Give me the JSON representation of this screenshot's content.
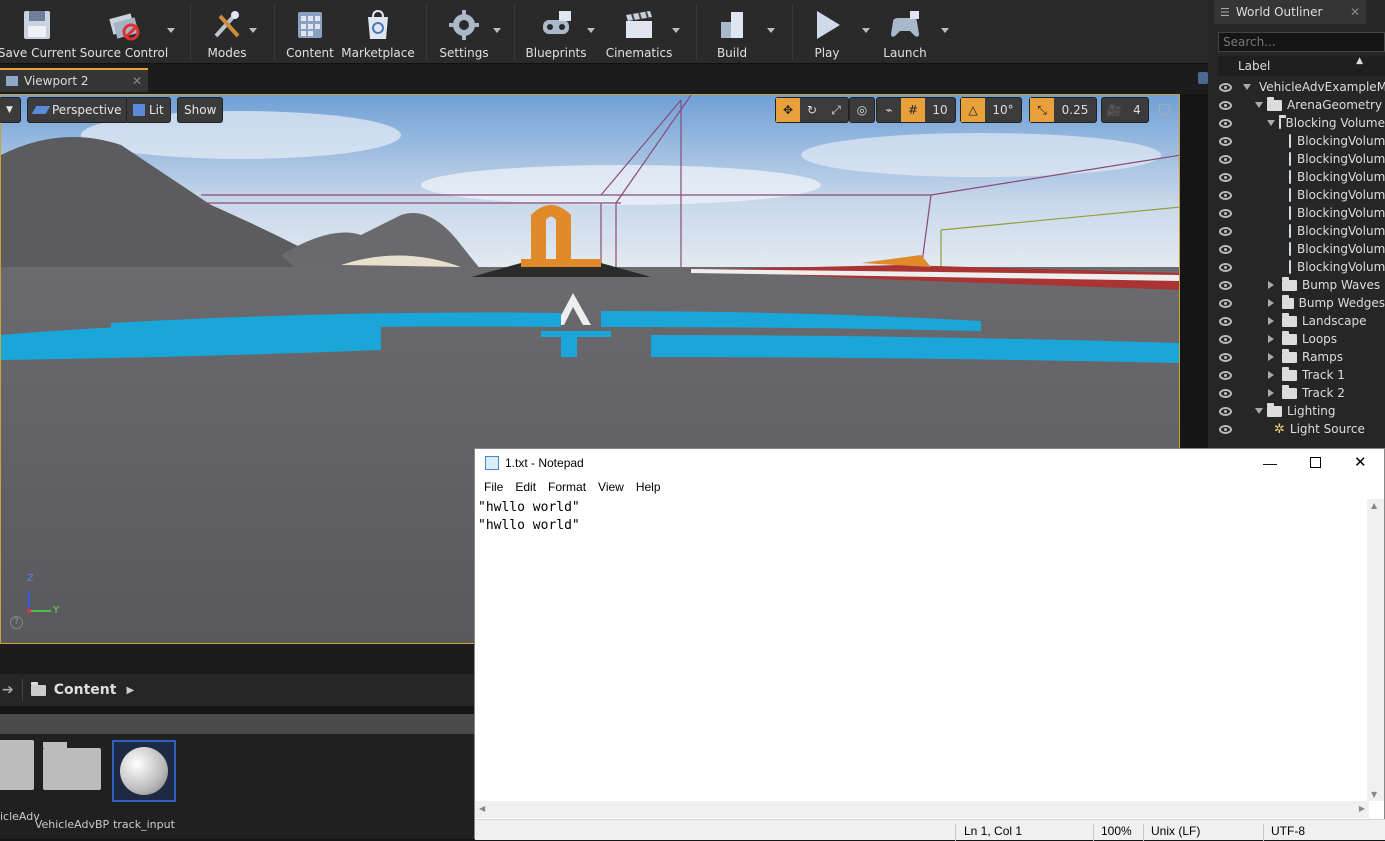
{
  "toolbar": {
    "save_current": "Save Current",
    "source_control": "Source Control",
    "modes": "Modes",
    "content": "Content",
    "marketplace": "Marketplace",
    "settings": "Settings",
    "blueprints": "Blueprints",
    "cinematics": "Cinematics",
    "build": "Build",
    "play": "Play",
    "launch": "Launch"
  },
  "viewport": {
    "tab_label": "Viewport 2",
    "perspective": "Perspective",
    "lit": "Lit",
    "show": "Show",
    "grid_snap": "10",
    "rotation_snap": "10°",
    "scale_snap": "0.25",
    "camera_speed": "4",
    "axis_z": "Z",
    "axis_y": "Y"
  },
  "content_browser": {
    "path_root": "Content",
    "assets": [
      {
        "name": "icleAdv"
      },
      {
        "name": "VehicleAdvBP"
      },
      {
        "name": "track_input"
      }
    ]
  },
  "outliner": {
    "title": "World Outliner",
    "search_placeholder": "Search...",
    "column_label": "Label",
    "items": [
      {
        "label": "VehicleAdvExampleM",
        "kind": "world"
      },
      {
        "label": "ArenaGeometry",
        "kind": "folder"
      },
      {
        "label": "Blocking Volume",
        "kind": "folder"
      },
      {
        "label": "BlockingVolum",
        "kind": "actor"
      },
      {
        "label": "BlockingVolum",
        "kind": "actor"
      },
      {
        "label": "BlockingVolum",
        "kind": "actor"
      },
      {
        "label": "BlockingVolum",
        "kind": "actor"
      },
      {
        "label": "BlockingVolum",
        "kind": "actor"
      },
      {
        "label": "BlockingVolum",
        "kind": "actor"
      },
      {
        "label": "BlockingVolum",
        "kind": "actor"
      },
      {
        "label": "BlockingVolum",
        "kind": "actor"
      },
      {
        "label": "Bump Waves",
        "kind": "folder"
      },
      {
        "label": "Bump Wedges",
        "kind": "folder"
      },
      {
        "label": "Landscape",
        "kind": "folder"
      },
      {
        "label": "Loops",
        "kind": "folder"
      },
      {
        "label": "Ramps",
        "kind": "folder"
      },
      {
        "label": "Track 1",
        "kind": "folder"
      },
      {
        "label": "Track 2",
        "kind": "folder"
      },
      {
        "label": "Lighting",
        "kind": "folder"
      },
      {
        "label": "Light Source",
        "kind": "light"
      }
    ]
  },
  "notepad": {
    "title": "1.txt - Notepad",
    "menu": [
      "File",
      "Edit",
      "Format",
      "View",
      "Help"
    ],
    "text": "\"hwllo world\"\n\"hwllo world\"",
    "status_position": "Ln 1, Col 1",
    "status_zoom": "100%",
    "status_eol": "Unix (LF)",
    "status_encoding": "UTF-8"
  },
  "colors": {
    "accent": "#e8a13a",
    "floor_text": "#1ba6d9"
  }
}
